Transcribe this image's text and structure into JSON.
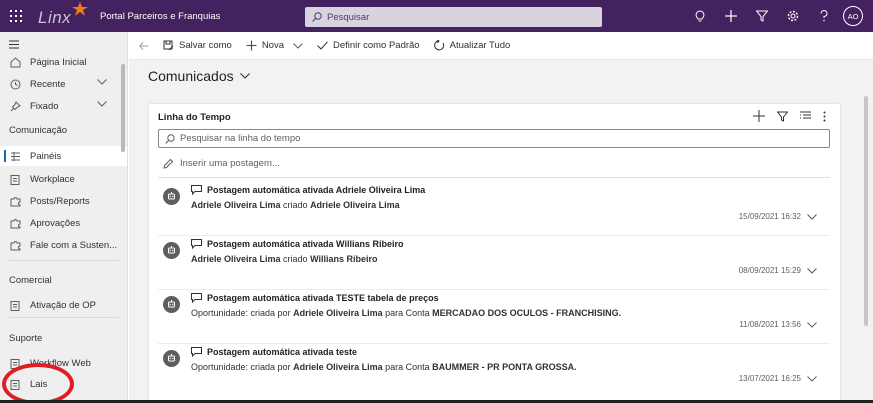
{
  "topbar": {
    "logo_text": "Linx",
    "app_title": "Portal Parceiros e Franquias",
    "search_placeholder": "Pesquisar",
    "avatar_initials": "AO",
    "background_color": "#44215f"
  },
  "sidebar": {
    "items": [
      {
        "label": "Página Inicial",
        "icon": "home-icon"
      },
      {
        "label": "Recente",
        "icon": "clock-icon"
      },
      {
        "label": "Fixado",
        "icon": "pin-icon"
      }
    ],
    "section_comunicacao": "Comunicação",
    "comunicacao_items": [
      {
        "label": "Painéis",
        "icon": "dashboard-icon"
      },
      {
        "label": "Workplace",
        "icon": "clipboard-icon"
      },
      {
        "label": "Posts/Reports",
        "icon": "puzzle-icon"
      },
      {
        "label": "Aprovações",
        "icon": "puzzle-icon"
      },
      {
        "label": "Fale com a Susten...",
        "icon": "puzzle-icon"
      }
    ],
    "section_comercial": "Comercial",
    "comercial_items": [
      {
        "label": "Ativação de OP",
        "icon": "clipboard-icon"
      }
    ],
    "section_suporte": "Suporte",
    "suporte_items": [
      {
        "label": "Workflow Web",
        "icon": "clipboard-icon"
      },
      {
        "label": "Lais",
        "icon": "clipboard-icon"
      }
    ],
    "active_item": "Painéis"
  },
  "command_bar": {
    "save_as": "Salvar como",
    "new": "Nova",
    "set_default": "Definir como Padrão",
    "refresh_all": "Atualizar Tudo"
  },
  "main": {
    "page_title": "Comunicados",
    "timeline": {
      "title": "Linha do Tempo",
      "search_placeholder": "Pesquisar na linha do tempo",
      "post_placeholder": "Inserir uma postagem...",
      "entries": [
        {
          "title": "Postagem automática ativada Adriele Oliveira Lima",
          "line2_a": "Adriele Oliveira Lima",
          "line2_b": " criado ",
          "line2_c": "Adriele Oliveira Lima",
          "line2_d": "",
          "line2_e": "",
          "date": "15/09/2021 16:32"
        },
        {
          "title": "Postagem automática ativada Willians Ribeiro",
          "line2_a": "Adriele Oliveira Lima",
          "line2_b": " criado ",
          "line2_c": "Willians Ribeiro",
          "line2_d": "",
          "line2_e": "",
          "date": "08/09/2021 15:29"
        },
        {
          "title": "Postagem automática ativada TESTE tabela de preços",
          "line2_pre": "Oportunidade: criada por ",
          "line2_a": "Adriele Oliveira Lima",
          "line2_b": " para Conta ",
          "line2_c": "MERCADAO DOS OCULOS - FRANCHISING.",
          "date": "11/08/2021 13:56"
        },
        {
          "title": "Postagem automática ativada teste",
          "line2_pre": "Oportunidade: criada por ",
          "line2_a": "Adriele Oliveira Lima",
          "line2_b": " para Conta ",
          "line2_c": "BAUMMER - PR PONTA GROSSA.",
          "date": "13/07/2021 16:25"
        }
      ]
    }
  }
}
